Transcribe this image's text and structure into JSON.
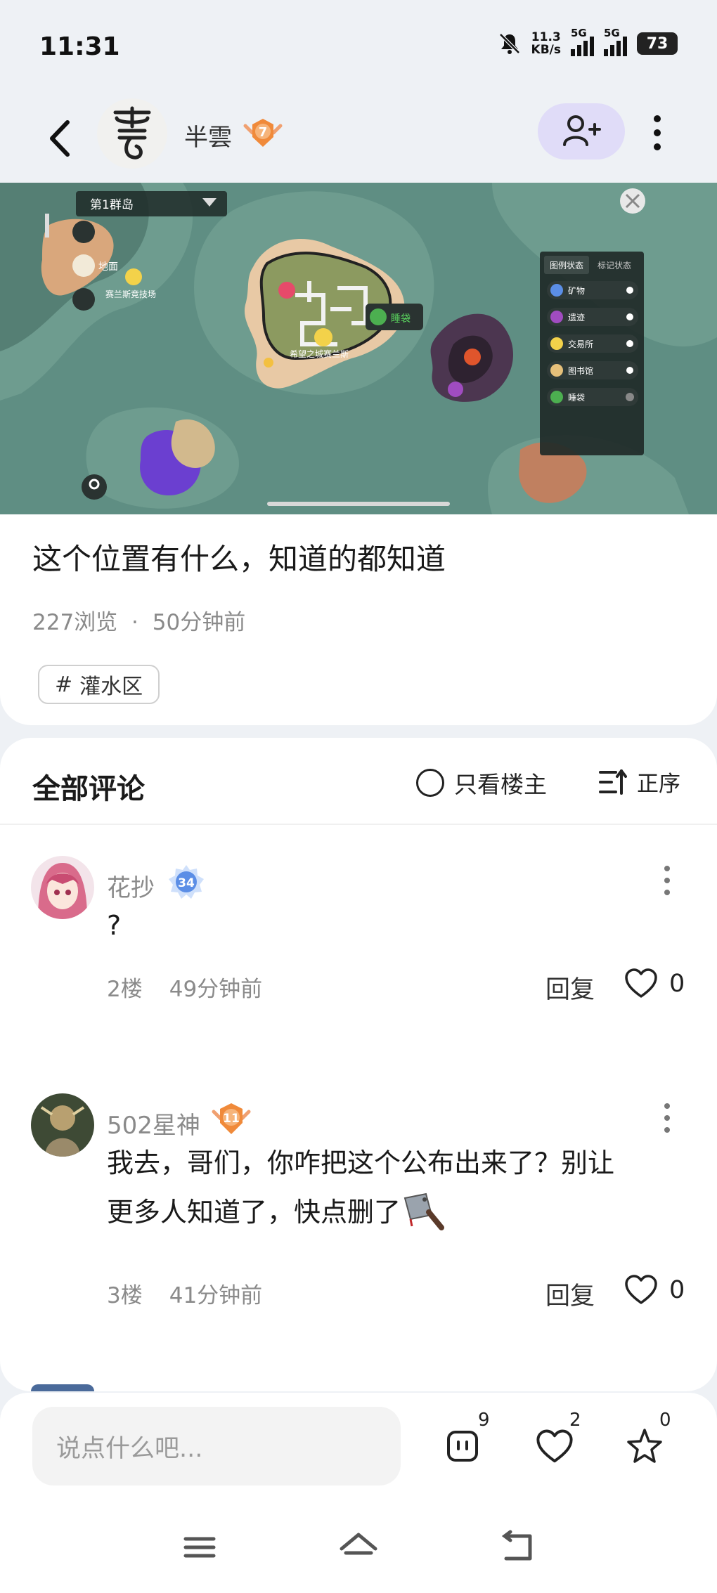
{
  "status_bar": {
    "time": "11:31",
    "net_speed_value": "11.3",
    "net_speed_unit": "KB/s",
    "sim1": "5G",
    "sim2": "5G",
    "battery": "73"
  },
  "header": {
    "author_name": "半雲",
    "author_level": "7",
    "icons": [
      "back-icon",
      "add-friend-icon",
      "more-vertical-icon"
    ]
  },
  "map_image": {
    "region_selector": "第1群岛",
    "left_labels": [
      "地面",
      "赛兰斯竞技场"
    ],
    "center_label": "希望之城赛兰斯",
    "legend_tabs": [
      "图例状态",
      "标记状态"
    ],
    "legend_items": [
      "矿物",
      "遗迹",
      "交易所",
      "图书馆",
      "睡袋"
    ],
    "marker_label": "睡袋"
  },
  "post": {
    "title": "这个位置有什么，知道的都知道",
    "views": "227浏览",
    "time": "50分钟前",
    "separator": "·",
    "tag": "灌水区",
    "tag_prefix": "#"
  },
  "comments_section": {
    "title": "全部评论",
    "only_owner_label": "只看楼主",
    "sort_label": "正序"
  },
  "comments": [
    {
      "user": "花抄",
      "level": "34",
      "text": "?",
      "floor": "2楼",
      "time": "49分钟前",
      "reply_label": "回复",
      "likes": "0"
    },
    {
      "user": "502星神",
      "level": "11",
      "text_line1": "我去，哥们，你咋把这个公布出来了？别让",
      "text_line2": "更多人知道了，快点删了",
      "emoji": "cleaver-icon",
      "floor": "3楼",
      "time": "41分钟前",
      "reply_label": "回复",
      "likes": "0"
    }
  ],
  "bottom_bar": {
    "input_placeholder": "说点什么吧...",
    "comment_count": "9",
    "like_count": "2",
    "favorite_count": "0"
  },
  "colors": {
    "accent": "#e0dcf8",
    "background": "#eef1f5",
    "map_sea": "#5f8e83",
    "level_orange": "#f08a3a",
    "level_blue": "#5b8ee6"
  }
}
